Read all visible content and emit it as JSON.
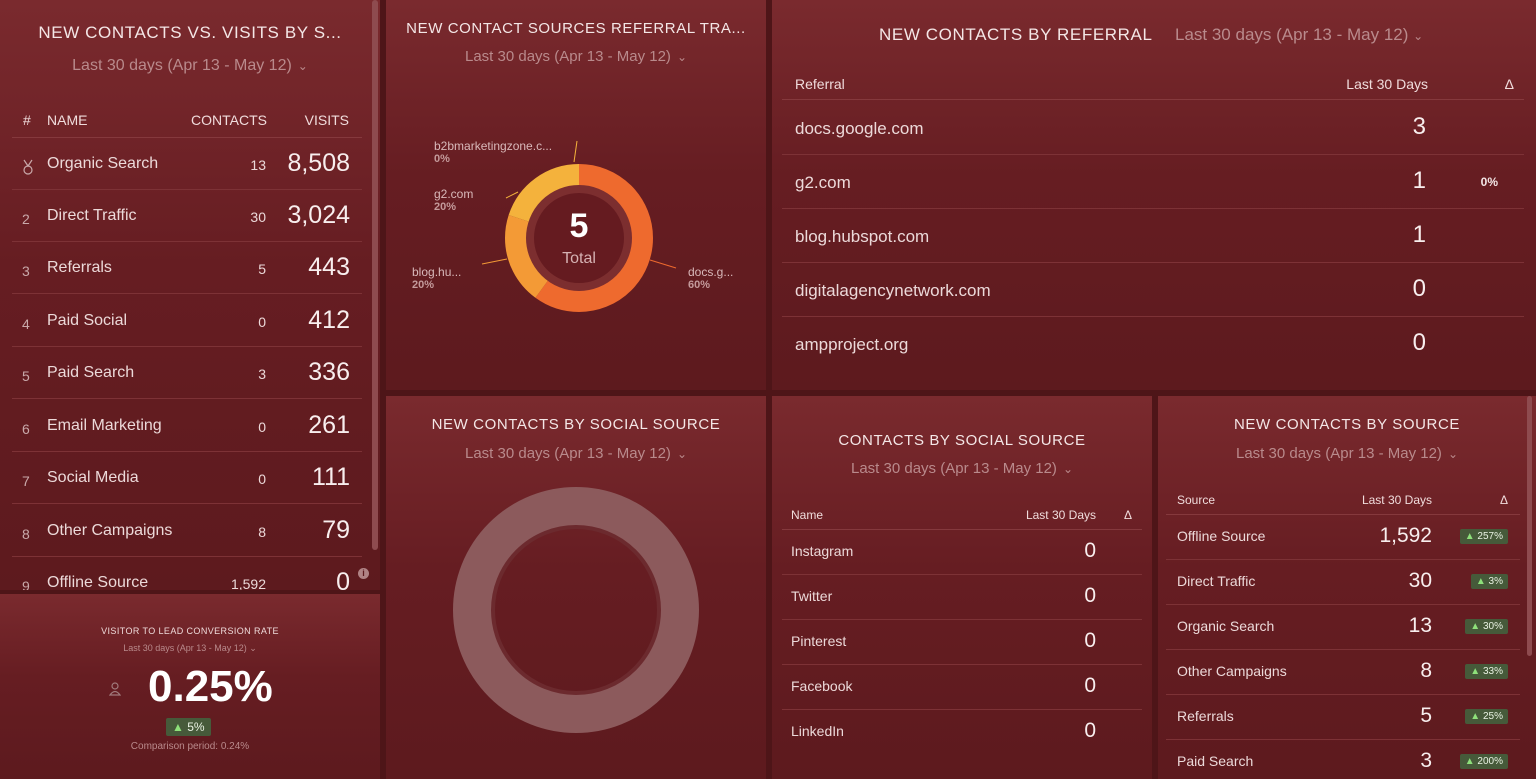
{
  "contacts_vs_visits": {
    "title": "NEW CONTACTS VS. VISITS BY S...",
    "range": "Last 30 days (Apr 13 - May 12)",
    "columns": {
      "rank": "#",
      "name": "NAME",
      "contacts": "CONTACTS",
      "visits": "VISITS"
    },
    "rows": [
      {
        "rank": "",
        "name": "Organic Search",
        "contacts": "13",
        "visits": "8,508"
      },
      {
        "rank": "2",
        "name": "Direct Traffic",
        "contacts": "30",
        "visits": "3,024"
      },
      {
        "rank": "3",
        "name": "Referrals",
        "contacts": "5",
        "visits": "443"
      },
      {
        "rank": "4",
        "name": "Paid Social",
        "contacts": "0",
        "visits": "412"
      },
      {
        "rank": "5",
        "name": "Paid Search",
        "contacts": "3",
        "visits": "336"
      },
      {
        "rank": "6",
        "name": "Email Marketing",
        "contacts": "0",
        "visits": "261"
      },
      {
        "rank": "7",
        "name": "Social Media",
        "contacts": "0",
        "visits": "111"
      },
      {
        "rank": "8",
        "name": "Other Campaigns",
        "contacts": "8",
        "visits": "79"
      },
      {
        "rank": "9",
        "name": "Offline Source",
        "contacts": "1,592",
        "visits": "0"
      }
    ]
  },
  "conversion_rate": {
    "title": "VISITOR TO LEAD CONVERSION RATE",
    "range": "Last 30 days (Apr 13 - May 12)",
    "value": "0.25%",
    "change": "5%",
    "comparison": "Comparison period: 0.24%"
  },
  "referral_traffic": {
    "title": "NEW CONTACT SOURCES REFERRAL TRA...",
    "range": "Last 30 days (Apr 13 - May 12)",
    "total_value": "5",
    "total_label": "Total",
    "colors": {
      "docs": "#ee6a2e",
      "blog": "#f39a36",
      "g2": "#f4b23c"
    },
    "labels": [
      {
        "name": "b2bmarketingzone.c...",
        "pct": "0%"
      },
      {
        "name": "g2.com",
        "pct": "20%"
      },
      {
        "name": "blog.hu...",
        "pct": "20%"
      },
      {
        "name": "docs.g...",
        "pct": "60%"
      }
    ]
  },
  "contacts_by_referral": {
    "title": "NEW CONTACTS BY REFERRAL",
    "range": "Last 30 days (Apr 13 - May 12)",
    "columns": {
      "name": "Referral",
      "value": "Last 30 Days",
      "delta": "Δ"
    },
    "rows": [
      {
        "name": "docs.google.com",
        "value": "3",
        "delta": ""
      },
      {
        "name": "g2.com",
        "value": "1",
        "delta": "0%"
      },
      {
        "name": "blog.hubspot.com",
        "value": "1",
        "delta": ""
      },
      {
        "name": "digitalagencynetwork.com",
        "value": "0",
        "delta": ""
      },
      {
        "name": "ampproject.org",
        "value": "0",
        "delta": ""
      }
    ]
  },
  "social_source": {
    "title": "NEW CONTACTS BY SOCIAL SOURCE",
    "range": "Last 30 days (Apr 13 - May 12)"
  },
  "contacts_social": {
    "title": "CONTACTS BY SOCIAL SOURCE",
    "range": "Last 30 days (Apr 13 - May 12)",
    "columns": {
      "name": "Name",
      "value": "Last 30 Days",
      "delta": "Δ"
    },
    "rows": [
      {
        "name": "Instagram",
        "value": "0"
      },
      {
        "name": "Twitter",
        "value": "0"
      },
      {
        "name": "Pinterest",
        "value": "0"
      },
      {
        "name": "Facebook",
        "value": "0"
      },
      {
        "name": "LinkedIn",
        "value": "0"
      }
    ]
  },
  "contacts_by_source": {
    "title": "NEW CONTACTS BY SOURCE",
    "range": "Last 30 days (Apr 13 - May 12)",
    "columns": {
      "name": "Source",
      "value": "Last 30 Days",
      "delta": "Δ"
    },
    "rows": [
      {
        "name": "Offline Source",
        "value": "1,592",
        "delta": "257%"
      },
      {
        "name": "Direct Traffic",
        "value": "30",
        "delta": "3%"
      },
      {
        "name": "Organic Search",
        "value": "13",
        "delta": "30%"
      },
      {
        "name": "Other Campaigns",
        "value": "8",
        "delta": "33%"
      },
      {
        "name": "Referrals",
        "value": "5",
        "delta": "25%"
      },
      {
        "name": "Paid Search",
        "value": "3",
        "delta": "200%"
      }
    ]
  }
}
